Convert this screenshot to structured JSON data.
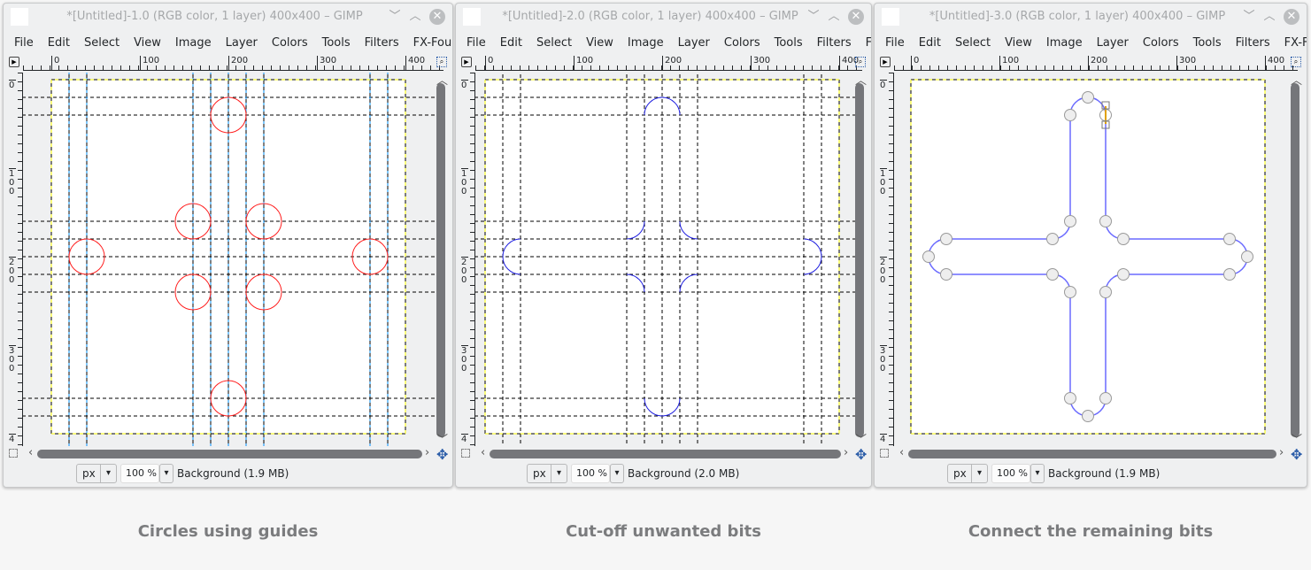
{
  "menu": [
    "File",
    "Edit",
    "Select",
    "View",
    "Image",
    "Layer",
    "Colors",
    "Tools",
    "Filters",
    "FX-Foundry"
  ],
  "ruler": {
    "h": [
      "0",
      "100",
      "200",
      "300",
      "400"
    ],
    "v": [
      "0",
      "1\n0\n0",
      "2\n0\n0",
      "3\n0\n0",
      "4"
    ]
  },
  "windows": [
    {
      "title": "*[Untitled]-1.0 (RGB color, 1 layer) 400x400 – GIMP",
      "unit": "px",
      "zoom": "100 %",
      "layer_info": "Background (1.9 MB)",
      "caption": "Circles using guides"
    },
    {
      "title": "*[Untitled]-2.0 (RGB color, 1 layer) 400x400 – GIMP",
      "unit": "px",
      "zoom": "100 %",
      "layer_info": "Background (2.0 MB)",
      "caption": "Cut-off unwanted bits"
    },
    {
      "title": "*[Untitled]-3.0 (RGB color, 1 layer) 400x400 – GIMP",
      "unit": "px",
      "zoom": "100 %",
      "layer_info": "Background (1.9 MB)",
      "caption": "Connect the remaining bits"
    }
  ],
  "colors": {
    "circle": "#ff2020",
    "arc": "#2020e0",
    "path": "#6a6aff",
    "guide_blue": "#0090ff",
    "selection": "#ffff00"
  }
}
